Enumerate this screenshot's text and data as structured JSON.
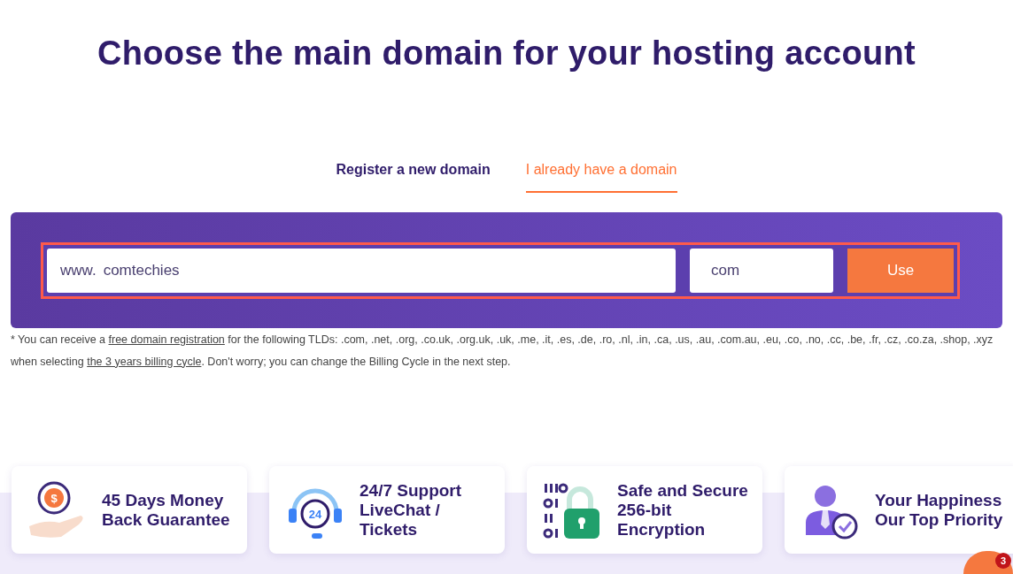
{
  "title": "Choose the main domain for your hosting account",
  "tabs": [
    {
      "label": "Register a new domain",
      "selected": false
    },
    {
      "label": "I already have a domain",
      "selected": true
    }
  ],
  "domain_form": {
    "prefix": "www.",
    "domain": "comtechies",
    "tld": "com",
    "button": "Use"
  },
  "note": [
    {
      "kind": "text",
      "text": "* You can receive a "
    },
    {
      "kind": "link",
      "text": "free domain registration"
    },
    {
      "kind": "text",
      "text": " for the following TLDs: .com, .net, .org, .co.uk, .org.uk, .uk, .me, .it, .es, .de, .ro, .nl, .in, .ca, .us, .au, .com.au, .eu, .co, .no, .cc, .be, .fr, .cz, .co.za, .shop, .xyz when selecting "
    },
    {
      "kind": "link",
      "text": "the 3 years billing cycle"
    },
    {
      "kind": "text",
      "text": ". Don't worry; you can change the Billing Cycle in the next step."
    }
  ],
  "features": [
    {
      "kind": "money",
      "icon_label": "$",
      "text": "45 Days Money Back Guarantee"
    },
    {
      "kind": "support",
      "icon_label": "24",
      "text": "24/7 Support LiveChat / Tickets"
    },
    {
      "kind": "security",
      "text": "Safe and Secure 256-bit Encryption"
    },
    {
      "kind": "happiness",
      "text": "Your Happiness Our Top Priority"
    }
  ],
  "chat": {
    "badge": "3"
  }
}
